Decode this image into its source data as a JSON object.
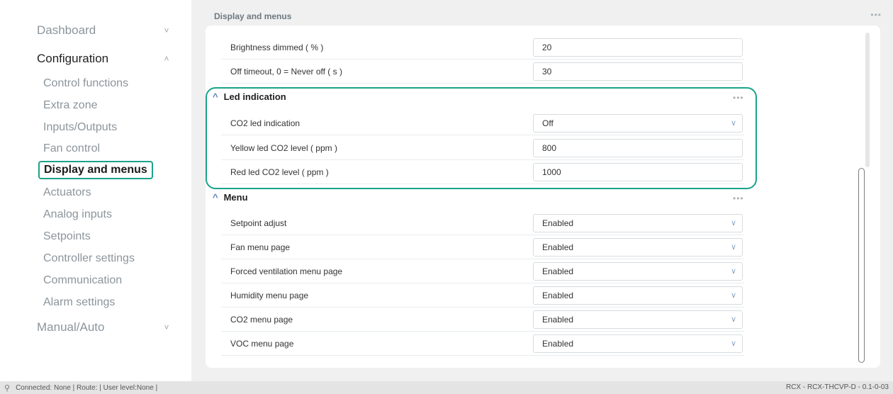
{
  "sidebar": {
    "groups": [
      {
        "label": "Dashboard",
        "chevron": "˅"
      },
      {
        "label": "Configuration",
        "chevron": "˄"
      },
      {
        "label": "Manual/Auto",
        "chevron": "˅"
      }
    ],
    "items": [
      {
        "label": "Control functions"
      },
      {
        "label": "Extra zone"
      },
      {
        "label": "Inputs/Outputs"
      },
      {
        "label": "Fan control"
      },
      {
        "label": "Display and menus"
      },
      {
        "label": "Actuators"
      },
      {
        "label": "Analog inputs"
      },
      {
        "label": "Setpoints"
      },
      {
        "label": "Controller settings"
      },
      {
        "label": "Communication"
      },
      {
        "label": "Alarm settings"
      }
    ]
  },
  "main": {
    "title": "Display and menus",
    "more": "•••",
    "rows_top": [
      {
        "label": "Brightness dimmed ( % )",
        "value": "20"
      },
      {
        "label": "Off timeout, 0 = Never off ( s )",
        "value": "30"
      }
    ],
    "led": {
      "title": "Led indication",
      "caret": "^",
      "more": "•••",
      "rows": [
        {
          "label": "CO2 led indication",
          "value": "Off",
          "dropdown": "∨"
        },
        {
          "label": "Yellow led CO2 level ( ppm )",
          "value": "800"
        },
        {
          "label": "Red led CO2 level ( ppm )",
          "value": "1000"
        }
      ]
    },
    "menu": {
      "title": "Menu",
      "caret": "^",
      "more": "•••",
      "rows": [
        {
          "label": "Setpoint adjust",
          "value": "Enabled",
          "dropdown": "∨"
        },
        {
          "label": "Fan menu page",
          "value": "Enabled",
          "dropdown": "∨"
        },
        {
          "label": "Forced ventilation menu page",
          "value": "Enabled",
          "dropdown": "∨"
        },
        {
          "label": "Humidity menu page",
          "value": "Enabled",
          "dropdown": "∨"
        },
        {
          "label": "CO2 menu page",
          "value": "Enabled",
          "dropdown": "∨"
        },
        {
          "label": "VOC menu page",
          "value": "Enabled",
          "dropdown": "∨"
        }
      ]
    }
  },
  "status": {
    "left": "Connected: None | Route: | User level:None |",
    "right": "RCX - RCX-THCVP-D - 0.1-0-03",
    "icon": "connection-icon"
  },
  "colors": {
    "accent": "#1aa38a",
    "caret": "#5b7db1"
  }
}
